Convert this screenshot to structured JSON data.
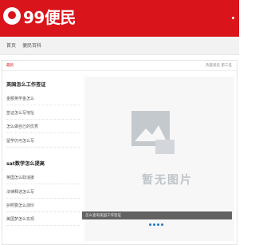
{
  "header": {
    "logo_text": "99便民",
    "brand_color": "#d9141a"
  },
  "nav": {
    "items": [
      {
        "label": "首页"
      },
      {
        "label": "便民百科"
      }
    ]
  },
  "breadcrumb": {
    "current": "最新",
    "right_text": "热度排名 第三名"
  },
  "sections": [
    {
      "title": "英国怎么工作签证",
      "items": [
        "金额英学金怎么",
        "签证怎么写地址",
        "怎么做自己的优秀",
        "留学仍可怎么写"
      ]
    },
    {
      "title": "sat数学怎么提高",
      "items": [
        "英国怎么取消援",
        "法律释述怎么写",
        "护照要怎么测印",
        "美国梦怎么实现"
      ]
    }
  ],
  "image": {
    "icon": "image-placeholder-icon",
    "placeholder_text": "暂无图片",
    "caption": "怎么查询美国工作签证"
  }
}
